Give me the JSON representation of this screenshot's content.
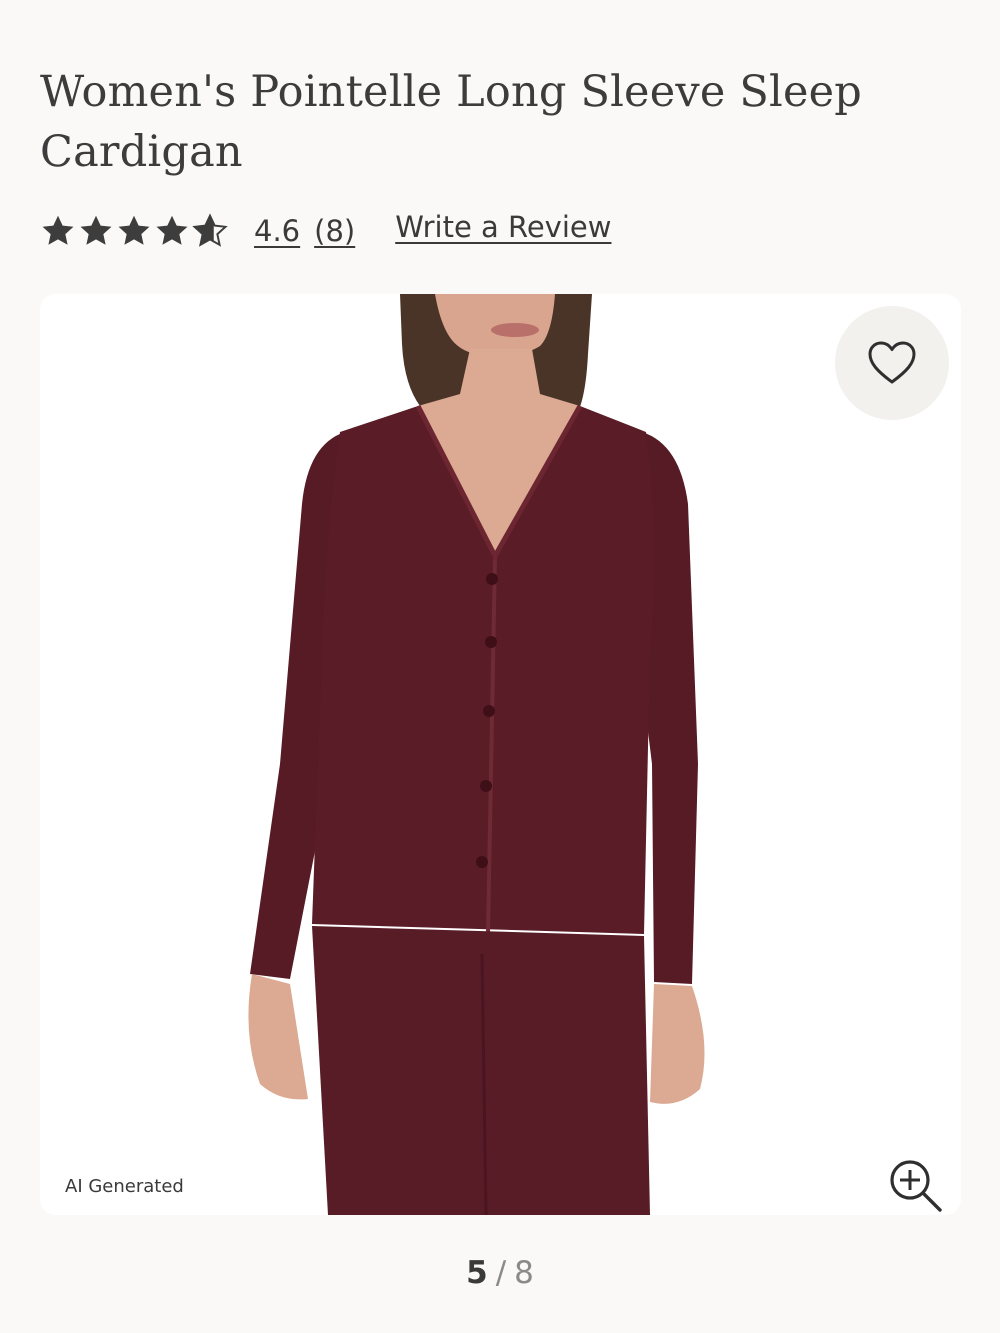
{
  "product": {
    "title": "Women's Pointelle Long Sleeve Sleep Cardigan",
    "rating_value": "4.6",
    "rating_count": "(8)",
    "rating_stars": 4.6,
    "write_review_label": "Write a Review"
  },
  "gallery": {
    "ai_label": "AI Generated",
    "current_page": "5",
    "separator": "/",
    "total_pages": "8",
    "favorite_icon": "heart-icon",
    "zoom_icon": "zoom-in-icon"
  },
  "colors": {
    "garment": "#5a1c26",
    "star": "#3d3d3d",
    "background": "#faf9f7"
  }
}
